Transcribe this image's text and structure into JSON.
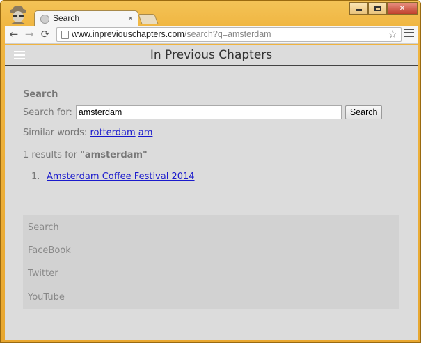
{
  "browser": {
    "tab_title": "Search",
    "tab_close": "×",
    "url_host": "www.inpreviouschapters.com",
    "url_path": "/search?q=amsterdam",
    "back_icon": "←",
    "forward_icon": "→",
    "reload_icon": "⟳",
    "star_icon": "☆"
  },
  "site": {
    "title": "In Previous Chapters"
  },
  "search": {
    "heading": "Search",
    "label": "Search for:",
    "query": "amsterdam",
    "button_label": "Search"
  },
  "similar": {
    "label": "Similar words:",
    "words": [
      "rotterdam",
      "am"
    ]
  },
  "results": {
    "count_prefix": "1 results for",
    "count_query": "\"amsterdam\"",
    "items": [
      {
        "number": "1.",
        "title": "Amsterdam Coffee Festival 2014"
      }
    ]
  },
  "footer": {
    "links": [
      "Search",
      "FaceBook",
      "Twitter",
      "YouTube"
    ]
  }
}
